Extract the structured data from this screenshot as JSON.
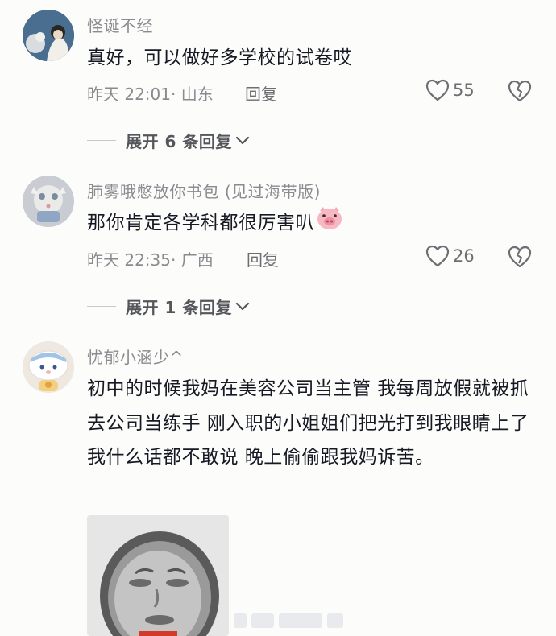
{
  "comments": [
    {
      "username": "怪诞不经",
      "text": "真好，可以做好多学校的试卷哎",
      "meta": "昨天 22:01· 山东",
      "reply": "回复",
      "likes": "55",
      "expand": "展开 6 条回复"
    },
    {
      "username": "肺雾哦憋放你书包 (见过海带版)",
      "text": "那你肯定各学科都很厉害叭",
      "emoji": "pig-emoji",
      "meta": "昨天 22:35· 广西",
      "reply": "回复",
      "likes": "26",
      "expand": "展开 1 条回复"
    },
    {
      "username": "忧郁小涵少^",
      "text": "初中的时候我妈在美容公司当主管 我每周放假就被抓去公司当练手 刚入职的小姐姐们把光打到我眼睛上了 我什么话都不敢说 晚上偷偷跟我妈诉苦。",
      "sticker": "dazed-face-sticker"
    }
  ],
  "icons": {
    "like": "heart-outline-icon",
    "dislike": "broken-heart-icon",
    "expand": "chevron-down-icon"
  },
  "colors": {
    "background": "#fcfcfa",
    "username": "#8a8b90",
    "text": "#161823"
  }
}
